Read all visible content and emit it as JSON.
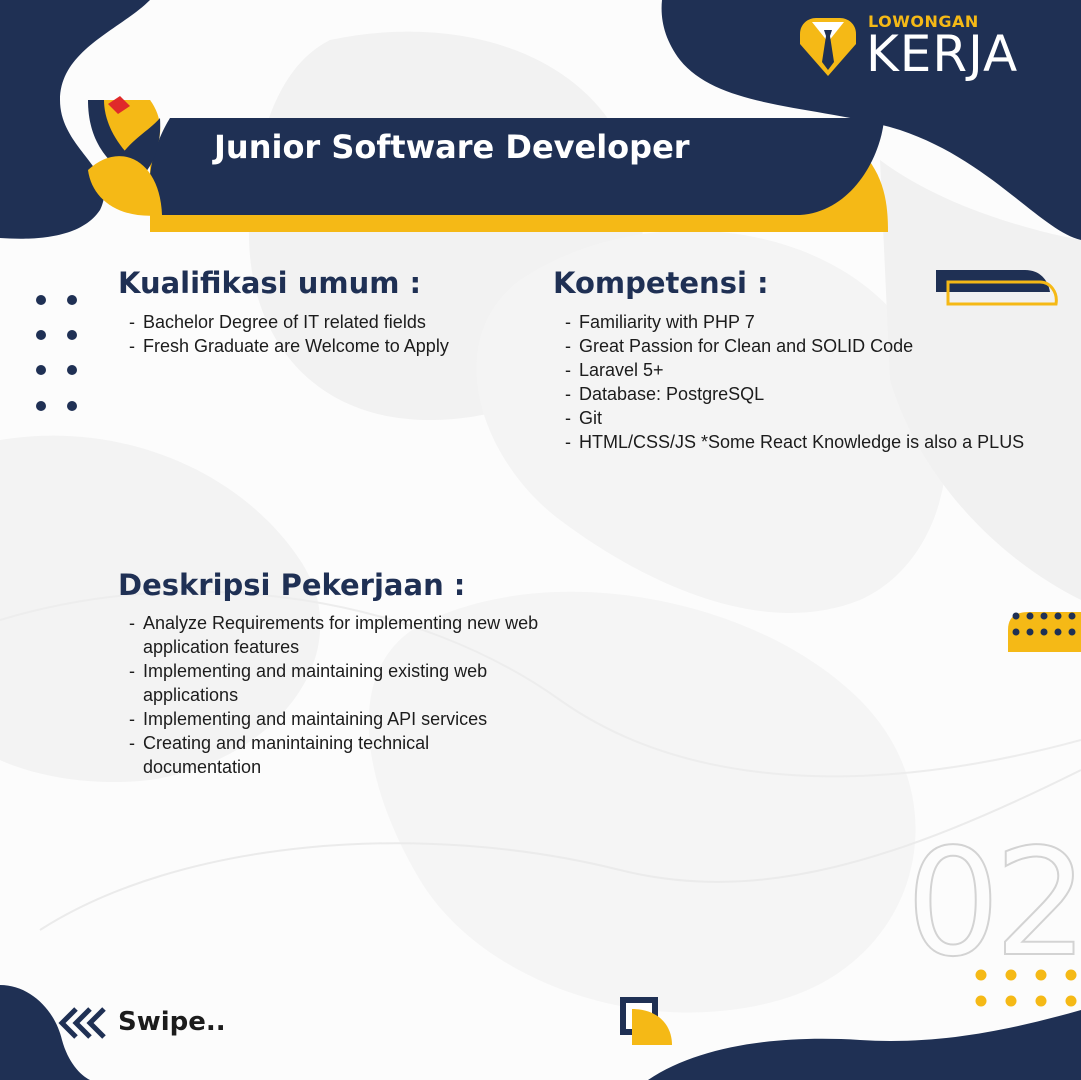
{
  "brand": {
    "top": "LOWONGAN",
    "main": "KERJA"
  },
  "job_title": "Junior Software Developer",
  "sections": {
    "kualifikasi": {
      "heading": "Kualifikasi umum :",
      "items": [
        "Bachelor Degree of IT related fields",
        "Fresh Graduate are Welcome to Apply"
      ]
    },
    "kompetensi": {
      "heading": "Kompetensi :",
      "items": [
        "Familiarity with PHP 7",
        "Great Passion for Clean and SOLID Code",
        "Laravel 5+",
        "Database: PostgreSQL",
        "Git",
        "HTML/CSS/JS *Some React Knowledge is also a PLUS"
      ]
    },
    "deskripsi": {
      "heading": "Deskripsi Pekerjaan :",
      "items": [
        "Analyze Requirements for implementing new web application features",
        "Implementing and maintaining existing web applications",
        "Implementing and maintaining API services",
        "Creating and manintaining technical documentation"
      ]
    }
  },
  "page_number": "02",
  "swipe_label": "Swipe..",
  "colors": {
    "navy": "#1f3054",
    "yellow": "#f5b916",
    "red": "#e02a2a",
    "ghost_number": "#d3d3d3"
  },
  "icons": [
    "tie-badge-icon",
    "swipe-chevrons-icon",
    "corner-leaf-icon",
    "title-ribbon-icon"
  ]
}
